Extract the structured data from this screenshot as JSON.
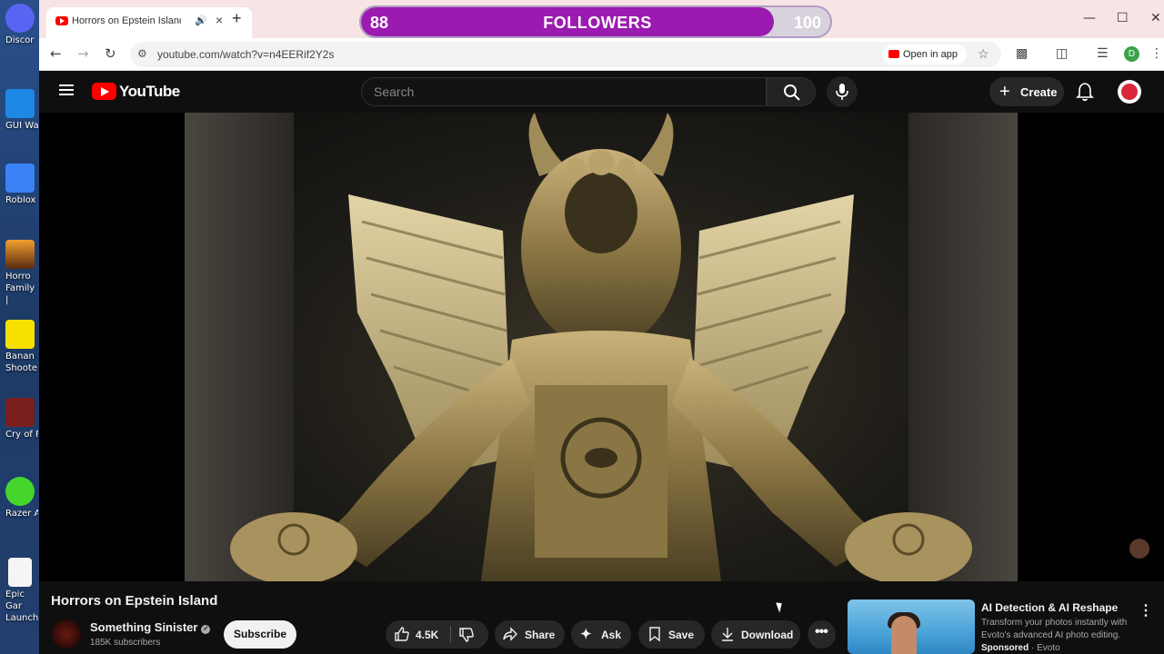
{
  "desktop": {
    "icons": [
      {
        "label": "Discor",
        "color": "#5865f2",
        "name": "discord-icon"
      },
      {
        "label": "GUI Wal",
        "color": "#1e88e5",
        "name": "gui-wallet-icon"
      },
      {
        "label": "Roblox Pl",
        "color": "#3b82f6",
        "name": "roblox-icon"
      },
      {
        "label": "Horro Family |",
        "color": "#8a4b1c",
        "name": "horror-family-icon"
      },
      {
        "label": "Banan Shoote",
        "color": "#f7e000",
        "name": "banana-shooter-icon"
      },
      {
        "label": "Cry of Fe",
        "color": "#7a1e1e",
        "name": "cry-of-fear-icon"
      },
      {
        "label": "Razer Ax",
        "color": "#44d62c",
        "name": "razer-axon-icon"
      },
      {
        "label": "Epic Gar Launch",
        "color": "#f5f5f5",
        "name": "epic-games-icon"
      }
    ]
  },
  "browser": {
    "tab_title": "Horrors on Epstein Island - YouTube",
    "tab_speaker_icon": "speaker-icon",
    "new_tab": "+",
    "url": "youtube.com/watch?v=n4EERif2Y2s",
    "open_in_app": "Open in app",
    "profile_initial": "D",
    "window_controls": {
      "minimize": "—",
      "maximize": "☐",
      "close": "✕"
    }
  },
  "overlay": {
    "current": "88",
    "label": "FOLLOWERS",
    "goal": "100",
    "progress": 0.88,
    "color": "#9b1bb0"
  },
  "youtube": {
    "logo_text": "YouTube",
    "search_placeholder": "Search",
    "create_label": "Create",
    "brand_color": "#ff0000"
  },
  "video": {
    "title": "Horrors on Epstein Island",
    "channel": "Something Sinister",
    "subscribers": "185K subscribers",
    "subscribe_label": "Subscribe",
    "likes": "4.5K",
    "share_label": "Share",
    "ask_label": "Ask",
    "save_label": "Save",
    "download_label": "Download"
  },
  "ad": {
    "headline": "AI Detection & AI Reshape",
    "description": "Transform your photos instantly with Evoto's advanced AI photo editing.",
    "sponsored": "Sponsored",
    "advertiser": "Evoto"
  }
}
